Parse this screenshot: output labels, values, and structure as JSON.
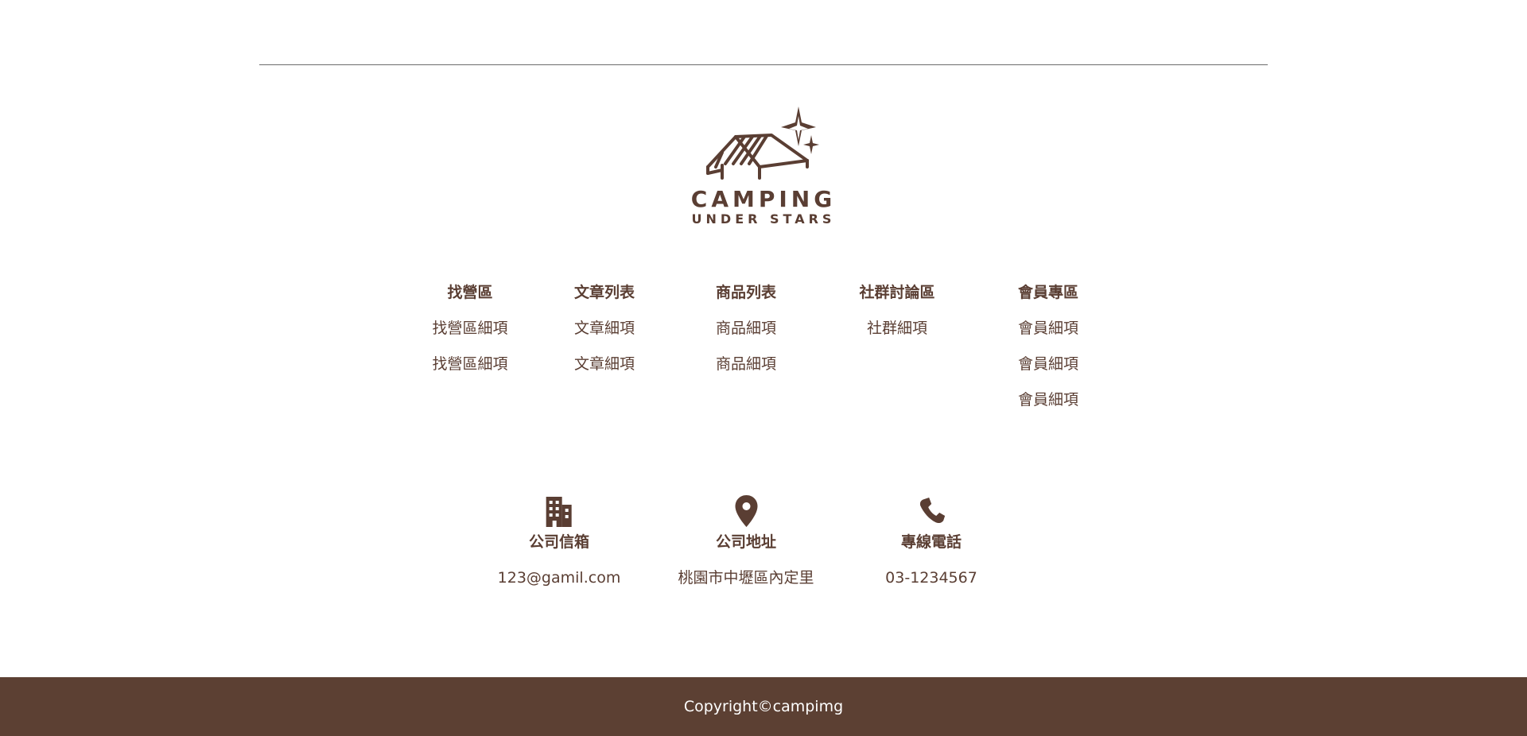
{
  "brand": {
    "name": "CAMPING",
    "tagline": "UNDER STARS"
  },
  "nav": [
    {
      "heading": "找營區",
      "items": [
        "找營區細項",
        "找營區細項"
      ]
    },
    {
      "heading": "文章列表",
      "items": [
        "文章細項",
        "文章細項"
      ]
    },
    {
      "heading": "商品列表",
      "items": [
        "商品細項",
        "商品細項"
      ]
    },
    {
      "heading": "社群討論區",
      "items": [
        "社群細項"
      ]
    },
    {
      "heading": "會員專區",
      "items": [
        "會員細項",
        "會員細項",
        "會員細項"
      ]
    }
  ],
  "contact": [
    {
      "icon": "building-icon",
      "label": "公司信箱",
      "value": "123@gamil.com"
    },
    {
      "icon": "map-pin-icon",
      "label": "公司地址",
      "value": "桃園市中壢區內定里"
    },
    {
      "icon": "phone-icon",
      "label": "專線電話",
      "value": "03-1234567"
    }
  ],
  "footer": {
    "copyright": "Copyright©campimg"
  },
  "colors": {
    "brand_brown": "#5c4033",
    "text_brown": "#5a3e33",
    "divider": "#6b6b6b",
    "footer_text": "#ffffff"
  }
}
